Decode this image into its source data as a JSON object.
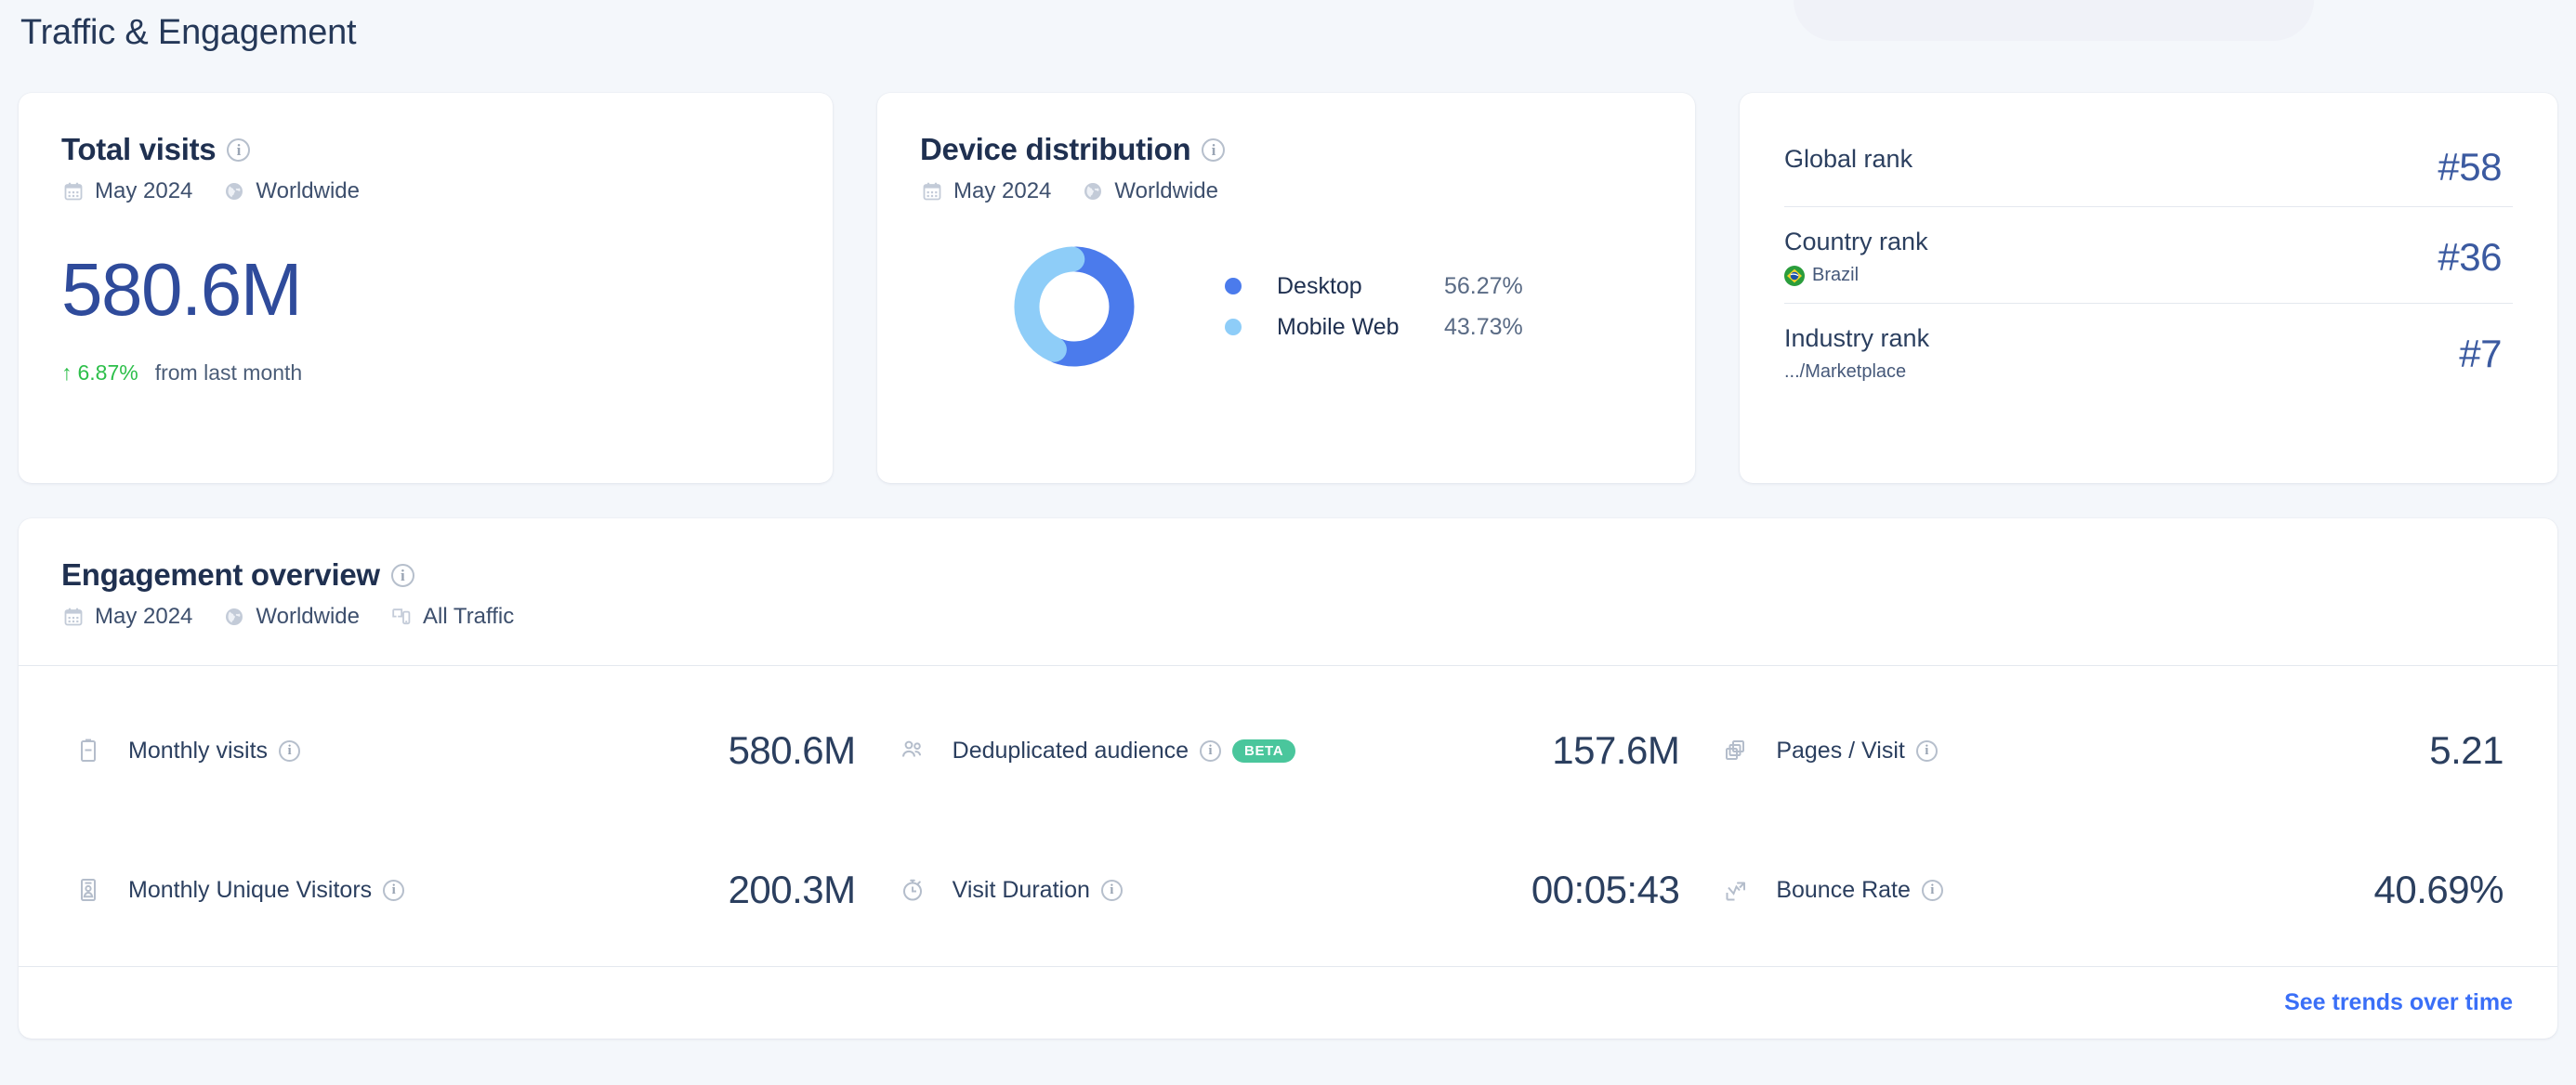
{
  "page": {
    "title": "Traffic & Engagement"
  },
  "icons": {
    "info": "info-circle-icon",
    "calendar": "calendar-icon",
    "globe": "globe-icon",
    "devices": "devices-icon"
  },
  "total_visits": {
    "title": "Total visits",
    "date": "May 2024",
    "region": "Worldwide",
    "value": "580.6M",
    "delta_arrow": "↑",
    "delta": "6.87%",
    "delta_note": "from last month",
    "delta_color": "#2dbf4a"
  },
  "device_distribution": {
    "title": "Device distribution",
    "date": "May 2024",
    "region": "Worldwide",
    "legend": [
      {
        "label": "Desktop",
        "value": "56.27%",
        "color": "#4b7bec"
      },
      {
        "label": "Mobile Web",
        "value": "43.73%",
        "color": "#8ecdf8"
      }
    ]
  },
  "chart_data": {
    "type": "pie",
    "title": "Device distribution",
    "categories": [
      "Desktop",
      "Mobile Web"
    ],
    "values": [
      56.27,
      43.73
    ],
    "colors": [
      "#4b7bec",
      "#8ecdf8"
    ],
    "donut": true,
    "legend_position": "right",
    "units": "%"
  },
  "ranks": [
    {
      "name": "Global rank",
      "sub": "",
      "value": "#58",
      "flag": ""
    },
    {
      "name": "Country rank",
      "sub": "Brazil",
      "value": "#36",
      "flag": "brazil-flag-icon"
    },
    {
      "name": "Industry rank",
      "sub": ".../Marketplace",
      "value": "#7",
      "flag": ""
    }
  ],
  "engagement": {
    "title": "Engagement overview",
    "date": "May 2024",
    "region": "Worldwide",
    "traffic": "All Traffic",
    "metrics": [
      {
        "icon": "monthly-visits-icon",
        "label": "Monthly visits",
        "badge": "",
        "value": "580.6M"
      },
      {
        "icon": "audience-icon",
        "label": "Deduplicated audience",
        "badge": "BETA",
        "value": "157.6M"
      },
      {
        "icon": "pages-visit-icon",
        "label": "Pages / Visit",
        "badge": "",
        "value": "5.21"
      },
      {
        "icon": "unique-visitors-icon",
        "label": "Monthly Unique Visitors",
        "badge": "",
        "value": "200.3M"
      },
      {
        "icon": "clock-icon",
        "label": "Visit Duration",
        "badge": "",
        "value": "00:05:43"
      },
      {
        "icon": "bounce-rate-icon",
        "label": "Bounce Rate",
        "badge": "",
        "value": "40.69%"
      }
    ],
    "footer_link": "See trends over time",
    "link_color": "#3a6ff7"
  }
}
